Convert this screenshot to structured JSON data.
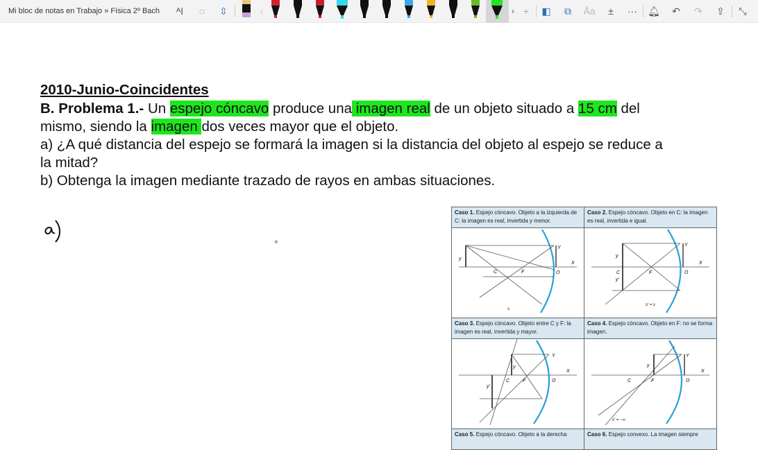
{
  "toolbar": {
    "breadcrumb": "Mi bloc de notas en Trabajo » Física 2º Bach",
    "icons": [
      "ink-to-text-icon",
      "lasso-select-icon",
      "add-space-icon",
      "eraser-pen",
      "pen-red",
      "pen-black",
      "pen-red-dark",
      "highlighter-cyan",
      "pen-black-pattern",
      "pen-black-2",
      "pen-blue",
      "pen-yellow",
      "pen-black-3",
      "pen-green",
      "highlighter-green",
      "add-pen-icon",
      "ink-to-shape-icon",
      "ink-replay-icon",
      "ink-to-text-convert-icon",
      "math-icon",
      "more-icon",
      "notifications-icon",
      "undo-icon",
      "redo-icon",
      "share-icon",
      "fullscreen-icon"
    ],
    "pen_colors": [
      "#e8c97a",
      "#d2232a",
      "#111111",
      "#c8202a",
      "#34d8e8",
      "#111111",
      "#111111",
      "#3aa8e8",
      "#f0b429",
      "#111111",
      "#6ab82e",
      "#22e622"
    ]
  },
  "note": {
    "title": "2010-Junio-Coincidentes",
    "line1": {
      "bold": "B. Problema 1.-",
      "t1": " Un ",
      "h1": "espejo cóncavo",
      "t2": " produce una",
      "h2": " imagen real",
      "t3": " de un objeto situado a ",
      "h3": "15 cm",
      "t4": " del"
    },
    "line2": {
      "t1": "mismo, siendo la ",
      "h1": "imagen ",
      "t2": "dos veces mayor que el objeto."
    },
    "line3": "a) ¿A qué distancia del espejo se formará la imagen si la distancia del objeto al espejo se reduce a",
    "line4": "la mitad?",
    "line5": "b) Obtenga la imagen mediante trazado de rayos en ambas situaciones.",
    "handwriting": "a)",
    "highlight_color": "#1ee61e"
  },
  "table": {
    "cases": [
      {
        "bold": "Caso 1.",
        "text": " Espejo cóncavo. Objeto a la izquierda de C: la imagen es real, invertida y menor."
      },
      {
        "bold": "Caso 2.",
        "text": " Espejo cóncavo. Objeto en C: la imagen es real, invertida e igual."
      },
      {
        "bold": "Caso 3.",
        "text": " Espejo cóncavo. Objeto entre C y F: la imagen es real, invertida y mayor."
      },
      {
        "bold": "Caso 4.",
        "text": " Espejo cóncavo. Objeto en F: no se forma imagen."
      },
      {
        "bold": "Caso 5.",
        "text": " Espejo cóncavo. Objeto a la derecha"
      },
      {
        "bold": "Caso 6.",
        "text": " Espejo convexo. La imagen siempre"
      }
    ],
    "labels": {
      "y": "y",
      "yp": "y'",
      "Y": "Y",
      "X": "X",
      "C": "C",
      "F": "F",
      "O": "O",
      "s": "s",
      "sp": "s'",
      "s2": "s' = s",
      "sinf": "s' = −∞"
    }
  }
}
